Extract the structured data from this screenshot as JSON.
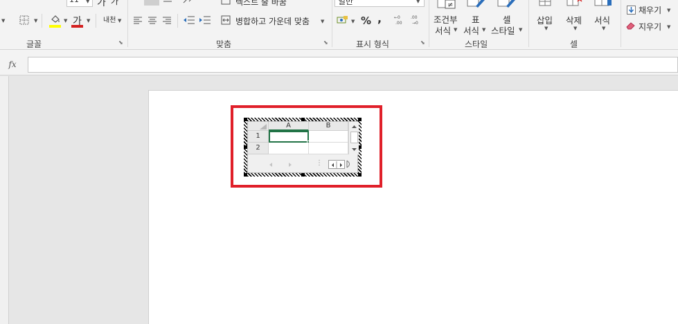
{
  "ribbon": {
    "font": {
      "size_value": "11",
      "bold_glyph": "가",
      "italic_glyph": "가",
      "font_color_glyph": "가",
      "phonetic_glyph": "내천",
      "group_label": "글꼴",
      "colors": {
        "fill_highlight": "#ffff00",
        "font_color": "#d42020"
      }
    },
    "alignment": {
      "wrap_label": "텍스트 줄 바꿈",
      "merge_label": "병합하고 가운데 맞춤",
      "group_label": "맞춤"
    },
    "number": {
      "format_value": "일반",
      "percent_glyph": "%",
      "comma_glyph": ",",
      "group_label": "표시 형식"
    },
    "styles": {
      "conditional_line1": "조건부",
      "conditional_line2": "서식",
      "table_line1": "표",
      "table_line2": "서식",
      "cell_line1": "셀",
      "cell_line2": "스타일",
      "group_label": "스타일"
    },
    "cells": {
      "insert_label": "삽입",
      "delete_label": "삭제",
      "format_label": "서식",
      "group_label": "셀"
    },
    "editing": {
      "fill_label": "채우기",
      "clear_label": "지우기"
    }
  },
  "formula_bar": {
    "fx_label": "fx",
    "value": ""
  },
  "embedded_sheet": {
    "columns": [
      "A",
      "B"
    ],
    "rows": [
      "1",
      "2"
    ]
  },
  "colors": {
    "accent_highlight": "#e0202a",
    "selection": "#217346"
  }
}
